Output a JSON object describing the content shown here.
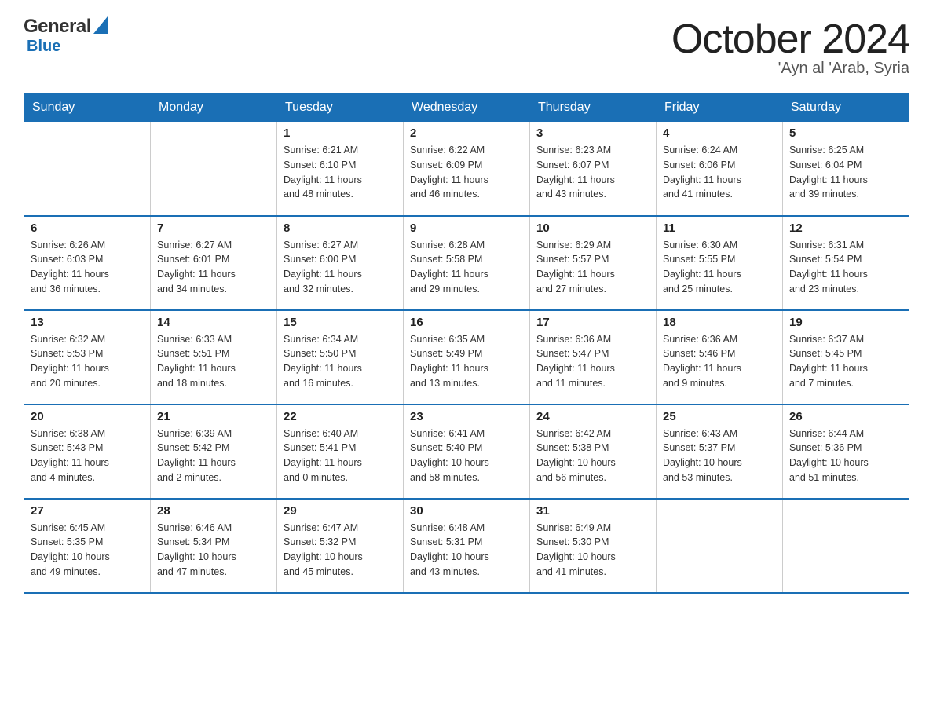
{
  "logo": {
    "general": "General",
    "blue": "Blue"
  },
  "title": "October 2024",
  "location": "'Ayn al 'Arab, Syria",
  "days_of_week": [
    "Sunday",
    "Monday",
    "Tuesday",
    "Wednesday",
    "Thursday",
    "Friday",
    "Saturday"
  ],
  "weeks": [
    [
      {
        "day": "",
        "info": ""
      },
      {
        "day": "",
        "info": ""
      },
      {
        "day": "1",
        "info": "Sunrise: 6:21 AM\nSunset: 6:10 PM\nDaylight: 11 hours\nand 48 minutes."
      },
      {
        "day": "2",
        "info": "Sunrise: 6:22 AM\nSunset: 6:09 PM\nDaylight: 11 hours\nand 46 minutes."
      },
      {
        "day": "3",
        "info": "Sunrise: 6:23 AM\nSunset: 6:07 PM\nDaylight: 11 hours\nand 43 minutes."
      },
      {
        "day": "4",
        "info": "Sunrise: 6:24 AM\nSunset: 6:06 PM\nDaylight: 11 hours\nand 41 minutes."
      },
      {
        "day": "5",
        "info": "Sunrise: 6:25 AM\nSunset: 6:04 PM\nDaylight: 11 hours\nand 39 minutes."
      }
    ],
    [
      {
        "day": "6",
        "info": "Sunrise: 6:26 AM\nSunset: 6:03 PM\nDaylight: 11 hours\nand 36 minutes."
      },
      {
        "day": "7",
        "info": "Sunrise: 6:27 AM\nSunset: 6:01 PM\nDaylight: 11 hours\nand 34 minutes."
      },
      {
        "day": "8",
        "info": "Sunrise: 6:27 AM\nSunset: 6:00 PM\nDaylight: 11 hours\nand 32 minutes."
      },
      {
        "day": "9",
        "info": "Sunrise: 6:28 AM\nSunset: 5:58 PM\nDaylight: 11 hours\nand 29 minutes."
      },
      {
        "day": "10",
        "info": "Sunrise: 6:29 AM\nSunset: 5:57 PM\nDaylight: 11 hours\nand 27 minutes."
      },
      {
        "day": "11",
        "info": "Sunrise: 6:30 AM\nSunset: 5:55 PM\nDaylight: 11 hours\nand 25 minutes."
      },
      {
        "day": "12",
        "info": "Sunrise: 6:31 AM\nSunset: 5:54 PM\nDaylight: 11 hours\nand 23 minutes."
      }
    ],
    [
      {
        "day": "13",
        "info": "Sunrise: 6:32 AM\nSunset: 5:53 PM\nDaylight: 11 hours\nand 20 minutes."
      },
      {
        "day": "14",
        "info": "Sunrise: 6:33 AM\nSunset: 5:51 PM\nDaylight: 11 hours\nand 18 minutes."
      },
      {
        "day": "15",
        "info": "Sunrise: 6:34 AM\nSunset: 5:50 PM\nDaylight: 11 hours\nand 16 minutes."
      },
      {
        "day": "16",
        "info": "Sunrise: 6:35 AM\nSunset: 5:49 PM\nDaylight: 11 hours\nand 13 minutes."
      },
      {
        "day": "17",
        "info": "Sunrise: 6:36 AM\nSunset: 5:47 PM\nDaylight: 11 hours\nand 11 minutes."
      },
      {
        "day": "18",
        "info": "Sunrise: 6:36 AM\nSunset: 5:46 PM\nDaylight: 11 hours\nand 9 minutes."
      },
      {
        "day": "19",
        "info": "Sunrise: 6:37 AM\nSunset: 5:45 PM\nDaylight: 11 hours\nand 7 minutes."
      }
    ],
    [
      {
        "day": "20",
        "info": "Sunrise: 6:38 AM\nSunset: 5:43 PM\nDaylight: 11 hours\nand 4 minutes."
      },
      {
        "day": "21",
        "info": "Sunrise: 6:39 AM\nSunset: 5:42 PM\nDaylight: 11 hours\nand 2 minutes."
      },
      {
        "day": "22",
        "info": "Sunrise: 6:40 AM\nSunset: 5:41 PM\nDaylight: 11 hours\nand 0 minutes."
      },
      {
        "day": "23",
        "info": "Sunrise: 6:41 AM\nSunset: 5:40 PM\nDaylight: 10 hours\nand 58 minutes."
      },
      {
        "day": "24",
        "info": "Sunrise: 6:42 AM\nSunset: 5:38 PM\nDaylight: 10 hours\nand 56 minutes."
      },
      {
        "day": "25",
        "info": "Sunrise: 6:43 AM\nSunset: 5:37 PM\nDaylight: 10 hours\nand 53 minutes."
      },
      {
        "day": "26",
        "info": "Sunrise: 6:44 AM\nSunset: 5:36 PM\nDaylight: 10 hours\nand 51 minutes."
      }
    ],
    [
      {
        "day": "27",
        "info": "Sunrise: 6:45 AM\nSunset: 5:35 PM\nDaylight: 10 hours\nand 49 minutes."
      },
      {
        "day": "28",
        "info": "Sunrise: 6:46 AM\nSunset: 5:34 PM\nDaylight: 10 hours\nand 47 minutes."
      },
      {
        "day": "29",
        "info": "Sunrise: 6:47 AM\nSunset: 5:32 PM\nDaylight: 10 hours\nand 45 minutes."
      },
      {
        "day": "30",
        "info": "Sunrise: 6:48 AM\nSunset: 5:31 PM\nDaylight: 10 hours\nand 43 minutes."
      },
      {
        "day": "31",
        "info": "Sunrise: 6:49 AM\nSunset: 5:30 PM\nDaylight: 10 hours\nand 41 minutes."
      },
      {
        "day": "",
        "info": ""
      },
      {
        "day": "",
        "info": ""
      }
    ]
  ]
}
